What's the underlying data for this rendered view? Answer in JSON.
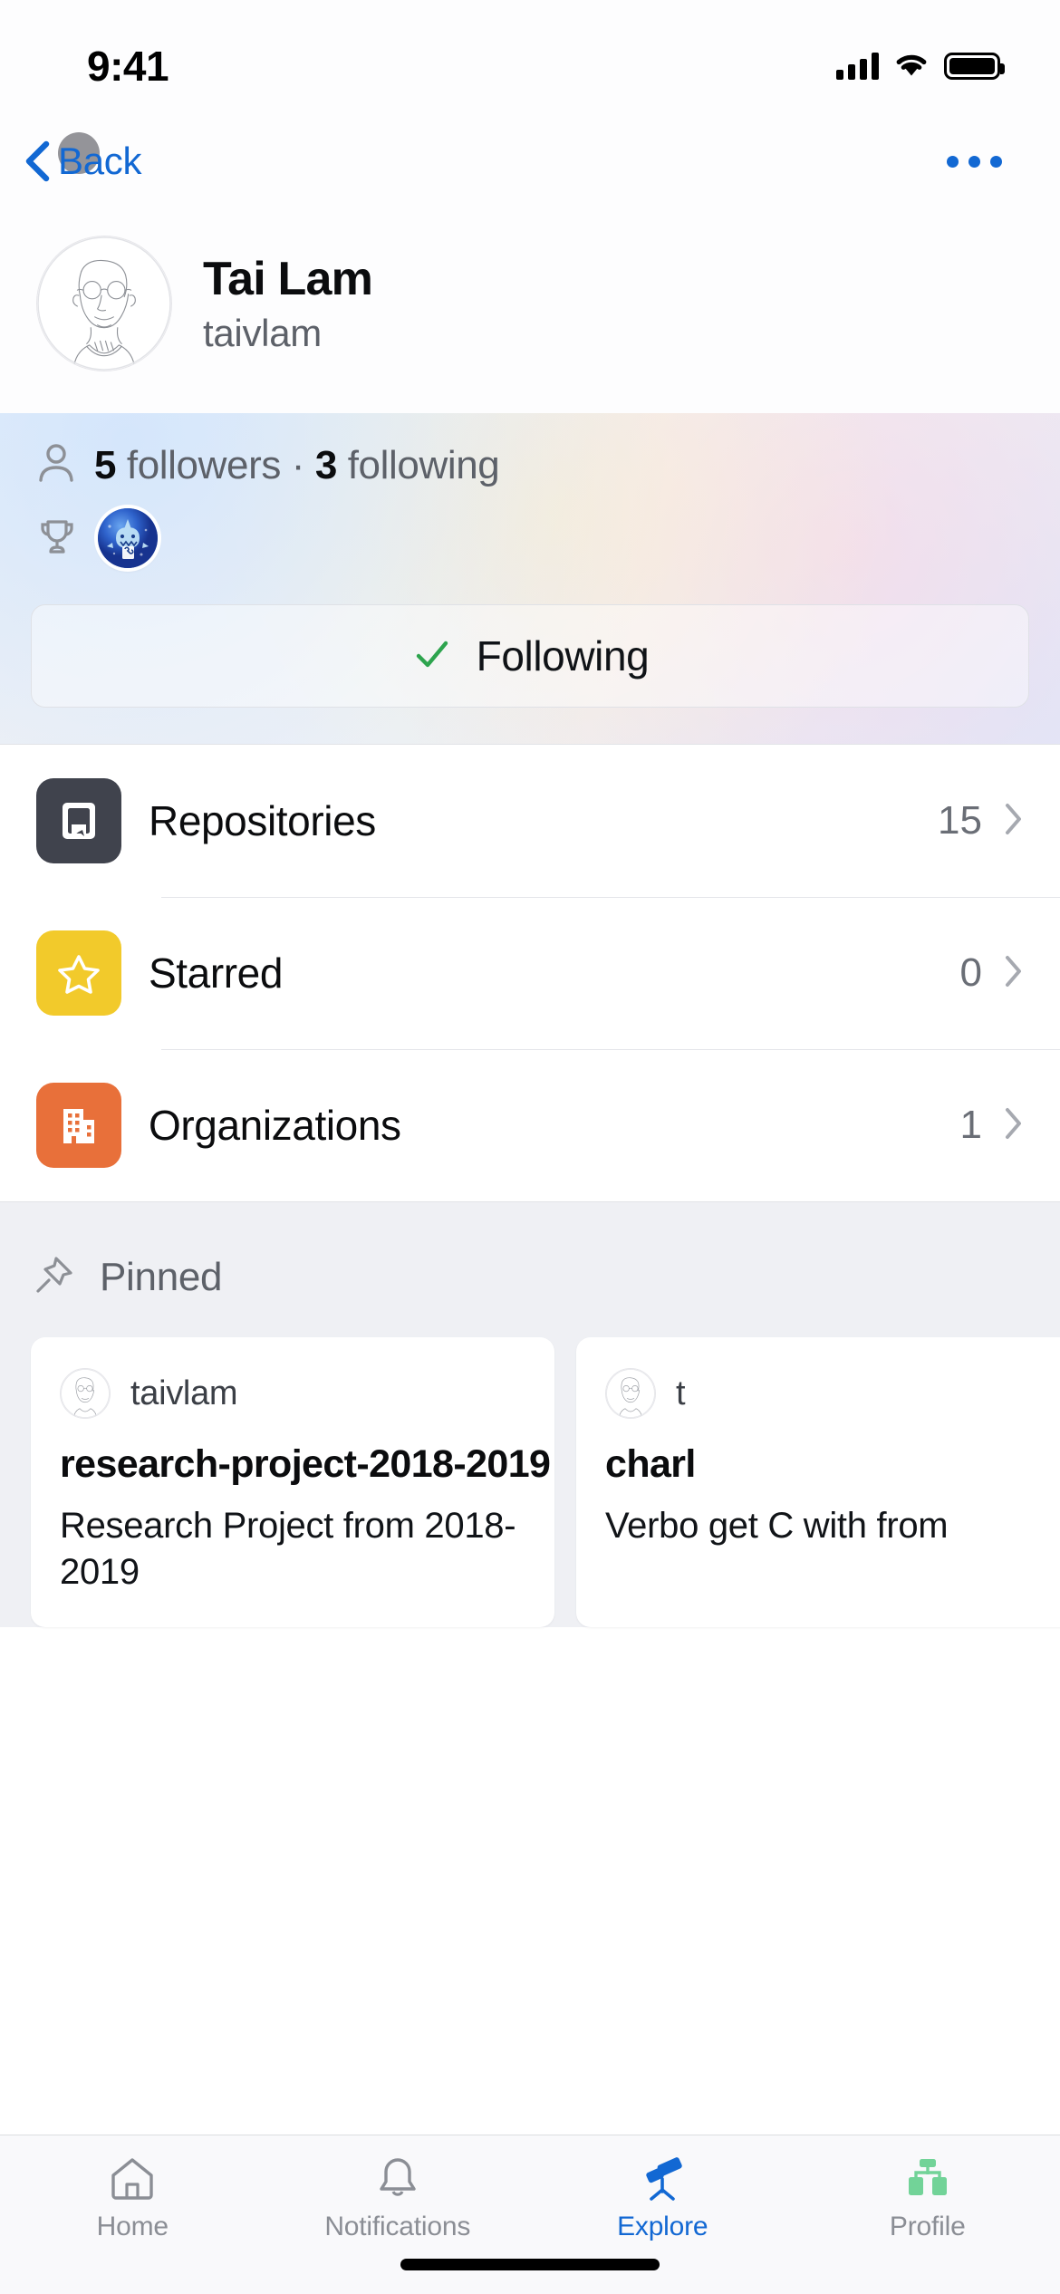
{
  "status_bar": {
    "time": "9:41",
    "signal_icon": "cellular-signal-icon",
    "wifi_icon": "wifi-icon",
    "battery_icon": "battery-full-icon"
  },
  "nav": {
    "back_label": "Back",
    "back_icon": "chevron-left-icon",
    "more_icon": "ellipsis-icon"
  },
  "profile": {
    "avatar_icon": "user-avatar-sketch",
    "display_name": "Tai Lam",
    "login": "taivlam",
    "person_icon": "person-icon",
    "followers_count": "5",
    "followers_label": " followers",
    "separator": " · ",
    "following_count": "3",
    "following_label": " following",
    "trophy_icon": "trophy-icon",
    "achievement_icon": "pull-shark-badge",
    "follow_button_label": "Following",
    "follow_check_icon": "check-icon",
    "follow_check_color": "#2da44e"
  },
  "lists": [
    {
      "label": "Repositories",
      "count": "15",
      "icon": "repo-icon",
      "color": "#40434d",
      "chevron": "chevron-right-icon"
    },
    {
      "label": "Starred",
      "count": "0",
      "icon": "star-icon",
      "color": "#f2ca2b",
      "chevron": "chevron-right-icon"
    },
    {
      "label": "Organizations",
      "count": "1",
      "icon": "organization-icon",
      "color": "#e8703a",
      "chevron": "chevron-right-icon"
    }
  ],
  "pinned": {
    "title": "Pinned",
    "pin_icon": "pin-icon",
    "cards": [
      {
        "owner": "taivlam",
        "owner_avatar": "user-avatar-sketch",
        "name": "research-project-2018-2019",
        "description": "Research Project from 2018-2019"
      },
      {
        "owner": "t",
        "owner_avatar": "user-avatar-sketch",
        "name": "charl",
        "description": "Verbo get C with from"
      }
    ]
  },
  "tab_bar": {
    "accent_color": "#1268d3",
    "tabs": [
      {
        "label": "Home",
        "icon": "home-icon",
        "active": false
      },
      {
        "label": "Notifications",
        "icon": "bell-icon",
        "active": false
      },
      {
        "label": "Explore",
        "icon": "telescope-icon",
        "active": true
      },
      {
        "label": "Profile",
        "icon": "profile-org-icon",
        "active": false
      }
    ]
  }
}
